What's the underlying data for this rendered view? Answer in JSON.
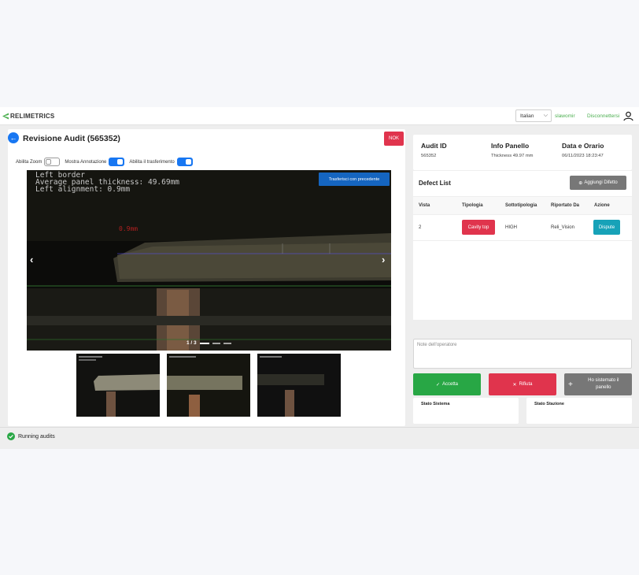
{
  "header": {
    "logo_text": "RELIMETRICS",
    "language": "Italian",
    "username": "slawomir",
    "logout_label": "Disconnettersi"
  },
  "audit": {
    "title": "Revisione Audit (565352)",
    "status_badge": "NOK"
  },
  "toggles": [
    {
      "label": "Abilita Zoom",
      "on": false
    },
    {
      "label": "Mostra Annotazione",
      "on": true
    },
    {
      "label": "Abilita il trasferimento",
      "on": true
    }
  ],
  "viewer": {
    "overlay_lines": "Left border\nAverage panel thickness: 49.69mm\nLeft alignment: 0.9mm",
    "overlay_red": "0.9mm",
    "transfer_button": "Trasferisci con precedente",
    "counter": "1 / 3",
    "prev_icon": "chevron-left",
    "next_icon": "chevron-right"
  },
  "info": {
    "audit_id_label": "Audit ID",
    "audit_id_value": "565352",
    "panel_label": "Info Panello",
    "panel_value": "Thickness 49.97 mm",
    "date_label": "Data e Orario",
    "date_value": "06/11/2023 18:23:47"
  },
  "defects": {
    "title": "Defect List",
    "add_button": "Aggiungi Difetto",
    "columns": [
      "Vista",
      "Tipologia",
      "Sottotipologia",
      "Riportato Da",
      "Azione"
    ],
    "rows": [
      {
        "vista": "2",
        "tipologia": "Cavity top",
        "sottotipologia": "HIGH",
        "riportato_da": "Reli_Vision",
        "azione": "Dispute"
      }
    ]
  },
  "note_placeholder": "Note dell'operatore",
  "actions": {
    "accept": "Accetta",
    "reject": "Rifiuta",
    "fixed": "Ho sistemato il panello"
  },
  "status": {
    "system": "Stato Sistema",
    "station": "Stato Stazione"
  },
  "footer": {
    "running": "Running audits"
  },
  "colors": {
    "primary": "#1877f2",
    "danger": "#e0344d",
    "success": "#28a745",
    "info": "#17a2b8",
    "link_green": "#4caf50"
  }
}
